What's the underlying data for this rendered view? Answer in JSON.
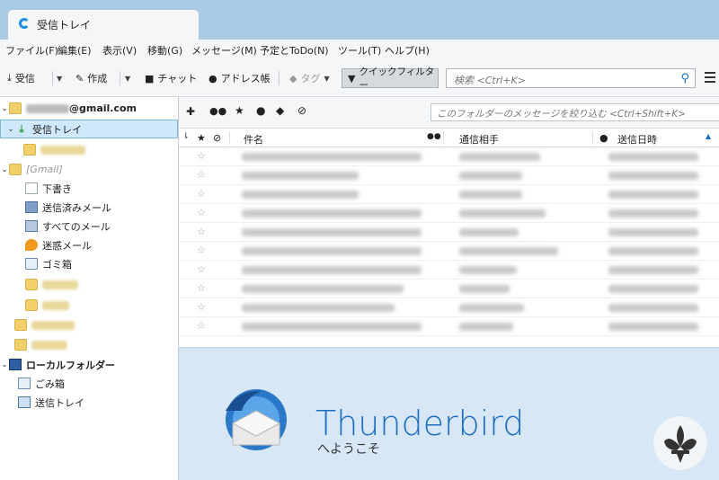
{
  "tab": {
    "title": "受信トレイ"
  },
  "menubar": [
    "ファイル(F)",
    "編集(E)",
    "表示(V)",
    "移動(G)",
    "メッセージ(M)",
    "予定とToDo(N)",
    "ツール(T)",
    "ヘルプ(H)"
  ],
  "toolbar": {
    "receive": "受信",
    "compose": "作成",
    "chat": "チャット",
    "addressbook": "アドレス帳",
    "tag": "タグ",
    "quickfilter": "クイックフィルター",
    "search_placeholder": "検索 <Ctrl+K>"
  },
  "folders": {
    "account": "@gmail.com",
    "inbox": "受信トレイ",
    "gmail": "[Gmail]",
    "drafts": "下書き",
    "sent": "送信済みメール",
    "all": "すべてのメール",
    "spam": "迷惑メール",
    "trash": "ゴミ箱",
    "local": "ローカルフォルダー",
    "local_trash": "ごみ箱",
    "outbox": "送信トレイ"
  },
  "filterbar": {
    "placeholder": "このフォルダーのメッセージを絞り込む <Ctrl+Shift+K>"
  },
  "columns": {
    "subject": "件名",
    "correspondent": "通信相手",
    "date": "送信日時"
  },
  "start": {
    "title": "Thunderbird",
    "subtitle": "へようこそ"
  },
  "colors": {
    "accent": "#1f6fbf",
    "selected": "#cfe8fc",
    "title_strip": "#a9cbe6"
  }
}
